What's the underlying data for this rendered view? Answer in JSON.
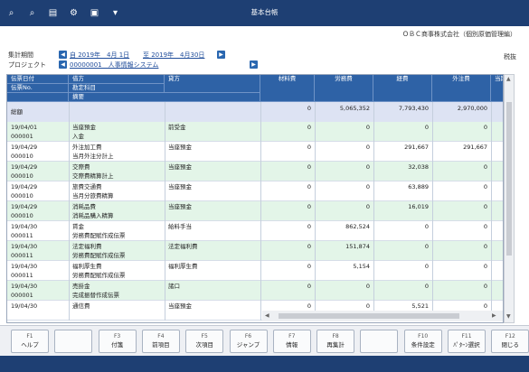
{
  "window": {
    "title": "基本台帳",
    "toolbar_icons": [
      "search-plus-icon",
      "search-icon",
      "print-icon",
      "settings-icon",
      "export-icon",
      "dropdown-icon"
    ]
  },
  "company": "ＯＢＣ商事株式会社（個別原価管理編）",
  "filters": {
    "period_label": "集計期間",
    "period_from": "自 2019年　4月 1日",
    "period_to": "至 2019年　4月30日",
    "project_label": "プロジェクト",
    "project_value": "00000001　人事情報システム",
    "tax_label": "税抜"
  },
  "table": {
    "headers": {
      "date": "伝票日付",
      "slip": "伝票No.",
      "debit": "借方",
      "account_sub": "勘定科目",
      "memo": "摘要",
      "credit": "貸方",
      "material": "材料費",
      "labor": "労務費",
      "expense": "経費",
      "outsource": "外注費",
      "current": "当期"
    },
    "total": {
      "label": "総額",
      "material": "0",
      "labor": "5,065,352",
      "expense": "7,793,430",
      "outsource": "2,970,000"
    },
    "rows": [
      {
        "date": "19/04/01",
        "slip": "000001",
        "debit": "当座預金",
        "memo": "入金",
        "credit": "前受金",
        "material": "0",
        "labor": "0",
        "expense": "0",
        "outsource": "0",
        "shade": "green"
      },
      {
        "date": "19/04/29",
        "slip": "000010",
        "debit": "外注加工費",
        "memo": "当月外注分計上",
        "credit": "当座預金",
        "material": "0",
        "labor": "0",
        "expense": "291,667",
        "outsource": "291,667",
        "shade": "white"
      },
      {
        "date": "19/04/29",
        "slip": "000010",
        "debit": "交際費",
        "memo": "交際費精算計上",
        "credit": "当座預金",
        "material": "0",
        "labor": "0",
        "expense": "32,038",
        "outsource": "0",
        "shade": "green"
      },
      {
        "date": "19/04/29",
        "slip": "000010",
        "debit": "旅費交通費",
        "memo": "当月分旅費精算",
        "credit": "当座預金",
        "material": "0",
        "labor": "0",
        "expense": "63,889",
        "outsource": "0",
        "shade": "white"
      },
      {
        "date": "19/04/29",
        "slip": "000010",
        "debit": "消耗品費",
        "memo": "消耗品購入精算",
        "credit": "当座預金",
        "material": "0",
        "labor": "0",
        "expense": "16,019",
        "outsource": "0",
        "shade": "green"
      },
      {
        "date": "19/04/30",
        "slip": "000011",
        "debit": "賃金",
        "memo": "労務費配賦作成伝票",
        "credit": "給料手当",
        "material": "0",
        "labor": "862,524",
        "expense": "0",
        "outsource": "0",
        "shade": "white"
      },
      {
        "date": "19/04/30",
        "slip": "000011",
        "debit": "法定福利費",
        "memo": "労務費配賦作成伝票",
        "credit": "法定福利費",
        "material": "0",
        "labor": "151,874",
        "expense": "0",
        "outsource": "0",
        "shade": "green"
      },
      {
        "date": "19/04/30",
        "slip": "000011",
        "debit": "福利厚生費",
        "memo": "労務費配賦作成伝票",
        "credit": "福利厚生費",
        "material": "0",
        "labor": "5,154",
        "expense": "0",
        "outsource": "0",
        "shade": "white"
      },
      {
        "date": "19/04/30",
        "slip": "000001",
        "debit": "売掛金",
        "memo": "完成振替作成伝票",
        "credit": "諸口",
        "material": "0",
        "labor": "0",
        "expense": "0",
        "outsource": "0",
        "shade": "green"
      },
      {
        "date": "19/04/30",
        "slip": "",
        "debit": "通信費",
        "memo": "",
        "credit": "当座預金",
        "material": "0",
        "labor": "0",
        "expense": "5,521",
        "outsource": "0",
        "shade": "white"
      }
    ]
  },
  "function_keys": [
    {
      "key": "F1",
      "label": "ヘルプ"
    },
    {
      "key": "",
      "label": ""
    },
    {
      "key": "F3",
      "label": "付箋"
    },
    {
      "key": "F4",
      "label": "前項目"
    },
    {
      "key": "F5",
      "label": "次項目"
    },
    {
      "key": "F6",
      "label": "ジャンプ"
    },
    {
      "key": "F7",
      "label": "情報"
    },
    {
      "key": "F8",
      "label": "再集計"
    },
    {
      "key": "",
      "label": ""
    },
    {
      "key": "F10",
      "label": "条件設定"
    },
    {
      "key": "F11",
      "label": "ﾊﾟﾀｰﾝ選択"
    },
    {
      "key": "F12",
      "label": "閉じる"
    }
  ]
}
